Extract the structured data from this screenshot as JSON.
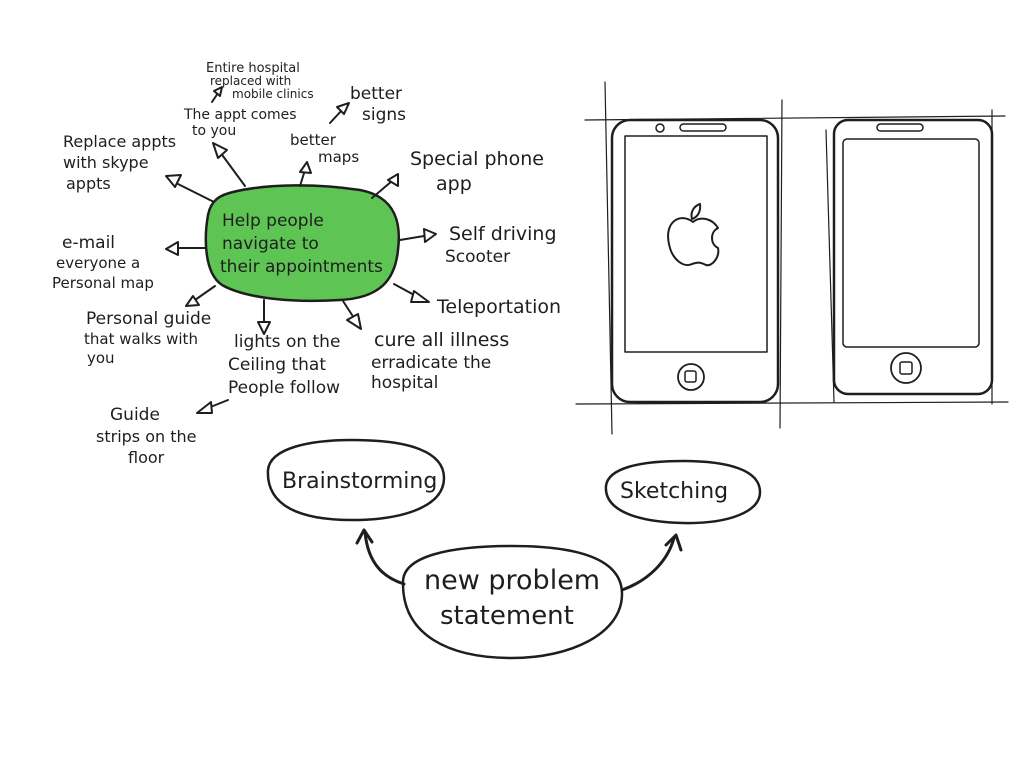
{
  "colors": {
    "ink": "#1e1e1e",
    "center_fill": "#5ec554",
    "background": "#ffffff",
    "phone_screen": "#ffffff"
  },
  "mindmap": {
    "center": {
      "lines": [
        "Help people",
        "navigate to",
        "their appointments"
      ]
    },
    "ideas": {
      "hospital": [
        "Entire hospital",
        "replaced with",
        "mobile clinics"
      ],
      "appt_comes": [
        "The appt comes",
        "to you"
      ],
      "better_signs": [
        "better",
        "signs"
      ],
      "better_maps": [
        "better",
        "maps"
      ],
      "skype": [
        "Replace appts",
        "with skype",
        "appts"
      ],
      "phone_app": [
        "Special phone",
        "app"
      ],
      "scooter": [
        "Self driving",
        "Scooter"
      ],
      "email": [
        "e-mail",
        "everyone a",
        "Personal map"
      ],
      "teleport": [
        "Teleportation"
      ],
      "guide": [
        "Personal guide",
        "that walks with",
        "you"
      ],
      "lights": [
        "lights on the",
        "Ceiling that",
        "People follow"
      ],
      "cure": [
        "cure all illness",
        "erradicate the",
        "hospital"
      ],
      "strips": [
        "Guide",
        "strips on the",
        "floor"
      ]
    }
  },
  "process": {
    "brainstorming": "Brainstorming",
    "sketching": "Sketching",
    "problem": [
      "new problem",
      "statement"
    ]
  },
  "sketch": {
    "left_phone_icon": "apple-logo-icon",
    "home_button_icon": "home-button-icon"
  }
}
